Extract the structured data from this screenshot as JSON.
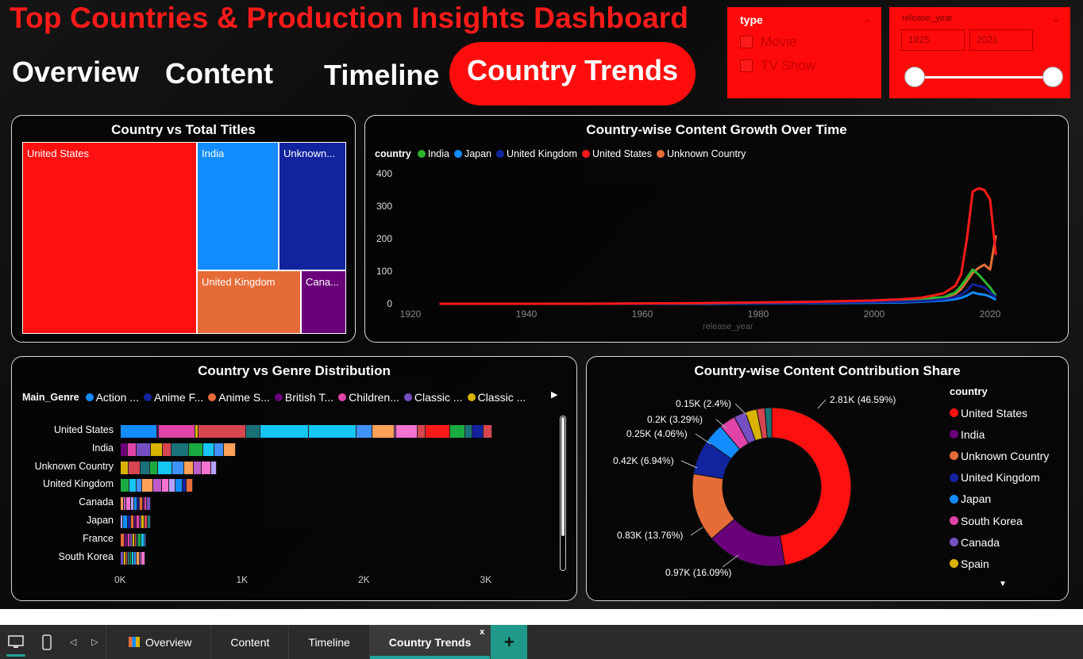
{
  "header": {
    "title": "Top Countries & Production Insights Dashboard",
    "tabs": [
      "Overview",
      "Content",
      "Timeline",
      "Country Trends"
    ],
    "active_tab": "Country Trends"
  },
  "slicers": {
    "type": {
      "title": "type",
      "options": [
        "Movie",
        "TV Show"
      ]
    },
    "release_year": {
      "title": "release_year",
      "start": "1925",
      "end": "2021"
    }
  },
  "treemap": {
    "title": "Country vs Total Titles",
    "cells": [
      {
        "label": "United States",
        "color": "#ff1010"
      },
      {
        "label": "India",
        "color": "#128cff"
      },
      {
        "label": "Unknown...",
        "color": "#12239e"
      },
      {
        "label": "United Kingdom",
        "color": "#e66c37"
      },
      {
        "label": "Cana...",
        "color": "#6b007b"
      }
    ]
  },
  "line_chart": {
    "title": "Country-wise Content Growth Over Time",
    "legend_title": "country",
    "xlabel": "release_year",
    "chart_data": {
      "type": "line",
      "x": [
        1925,
        1940,
        1950,
        1960,
        1970,
        1980,
        1990,
        2000,
        2005,
        2008,
        2010,
        2012,
        2014,
        2015,
        2016,
        2017,
        2018,
        2019,
        2020,
        2021
      ],
      "xlim": [
        1920,
        2020
      ],
      "ylim": [
        0,
        400
      ],
      "xticks": [
        "1920",
        "1940",
        "1960",
        "1980",
        "2000",
        "2020"
      ],
      "yticks": [
        "0",
        "100",
        "200",
        "300",
        "400"
      ],
      "series": [
        {
          "name": "India",
          "color": "#2db52d",
          "values": [
            0,
            0,
            0,
            0,
            1,
            2,
            3,
            6,
            8,
            12,
            18,
            20,
            35,
            55,
            80,
            105,
            90,
            70,
            50,
            25
          ]
        },
        {
          "name": "Japan",
          "color": "#128cff",
          "values": [
            0,
            0,
            0,
            0,
            0,
            1,
            2,
            3,
            4,
            6,
            8,
            10,
            14,
            18,
            25,
            35,
            30,
            28,
            22,
            12
          ]
        },
        {
          "name": "United Kingdom",
          "color": "#12239e",
          "values": [
            0,
            0,
            0,
            0,
            1,
            2,
            3,
            5,
            6,
            8,
            10,
            14,
            20,
            28,
            40,
            60,
            55,
            50,
            35,
            20
          ]
        },
        {
          "name": "United States",
          "color": "#ff1a1a",
          "values": [
            0,
            0,
            0,
            1,
            2,
            4,
            6,
            10,
            14,
            18,
            25,
            32,
            55,
            90,
            200,
            345,
            355,
            350,
            320,
            150
          ]
        },
        {
          "name": "Unknown Country",
          "color": "#e66c37",
          "values": [
            0,
            0,
            0,
            0,
            1,
            2,
            3,
            5,
            7,
            10,
            14,
            18,
            30,
            45,
            70,
            95,
            110,
            120,
            105,
            210
          ]
        }
      ]
    }
  },
  "genre_chart": {
    "title": "Country vs Genre Distribution",
    "legend_title": "Main_Genre",
    "legend": [
      {
        "name": "Action ...",
        "color": "#128cff"
      },
      {
        "name": "Anime F...",
        "color": "#12239e"
      },
      {
        "name": "Anime S...",
        "color": "#e66c37"
      },
      {
        "name": "British T...",
        "color": "#6b007b"
      },
      {
        "name": "Children...",
        "color": "#e044a7"
      },
      {
        "name": "Classic ...",
        "color": "#744ec2"
      },
      {
        "name": "Classic ...",
        "color": "#d9b300"
      }
    ],
    "chart_data": {
      "type": "bar",
      "orientation": "horizontal",
      "stacked": true,
      "categories": [
        "United States",
        "India",
        "Unknown Country",
        "United Kingdom",
        "Canada",
        "Japan",
        "France",
        "South Korea"
      ],
      "totals": [
        3200,
        990,
        830,
        620,
        260,
        260,
        220,
        210
      ],
      "xlim": [
        0,
        3500
      ],
      "xticks": [
        "0K",
        "1K",
        "2K",
        "3K"
      ]
    }
  },
  "donut_chart": {
    "title": "Country-wise Content Contribution Share",
    "legend_title": "country",
    "chart_data": {
      "type": "pie",
      "labels": [
        "United States",
        "India",
        "Unknown Country",
        "United Kingdom",
        "Japan",
        "South Korea",
        "Canada",
        "Spain",
        "Other 1",
        "Other 2"
      ],
      "values": [
        46.59,
        16.09,
        13.76,
        6.94,
        4.06,
        3.29,
        2.4,
        2.3,
        1.6,
        1.4
      ],
      "colors": [
        "#ff1010",
        "#6b007b",
        "#e66c37",
        "#12239e",
        "#128cff",
        "#e044a7",
        "#744ec2",
        "#d9b300",
        "#d64550",
        "#197278"
      ],
      "data_labels": [
        "2.81K (46.59%)",
        "0.97K (16.09%)",
        "0.83K (13.76%)",
        "0.42K (6.94%)",
        "0.25K (4.06%)",
        "0.2K (3.29%)",
        "0.15K (2.4%)"
      ]
    },
    "legend_items": [
      "United States",
      "India",
      "Unknown Country",
      "United Kingdom",
      "Japan",
      "South Korea",
      "Canada",
      "Spain"
    ]
  },
  "bottom_tabs": [
    "Overview",
    "Content",
    "Timeline",
    "Country Trends"
  ],
  "bottom_close": "x",
  "bottom_add": "+"
}
